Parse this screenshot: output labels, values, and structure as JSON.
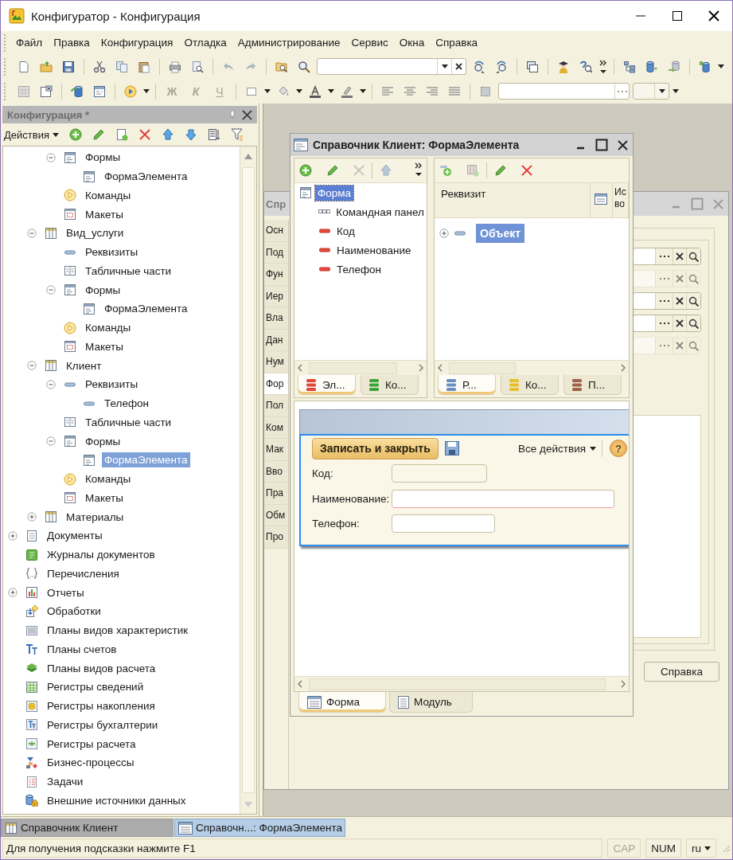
{
  "window": {
    "title": "Конфигуратор - Конфигурация"
  },
  "menu": [
    "Файл",
    "Правка",
    "Конфигурация",
    "Отладка",
    "Администрирование",
    "Сервис",
    "Окна",
    "Справка"
  ],
  "format_buttons": [
    {
      "label": "Ж",
      "disabled": true
    },
    {
      "label": "К",
      "disabled": true
    },
    {
      "label": "Ч",
      "disabled": true
    }
  ],
  "config": {
    "title": "Конфигурация *",
    "actions_label": "Действия",
    "tree": [
      {
        "children": [
          {
            "children": [
              {
                "label": "Формы",
                "kind": "forms",
                "expanded": true,
                "selected": false,
                "children": [
                  {
                    "label": "ФормаЭлемента",
                    "kind": "form",
                    "selected": false
                  }
                ]
              },
              {
                "label": "Команды",
                "kind": "commands",
                "selected": false
              },
              {
                "label": "Макеты",
                "kind": "templates",
                "selected": false
              }
            ]
          },
          {
            "label": "Вид_услуги",
            "kind": "catalog",
            "expanded": true,
            "selected": false,
            "children": [
              {
                "label": "Реквизиты",
                "kind": "attributes",
                "selected": false
              },
              {
                "label": "Табличные части",
                "kind": "tabular",
                "selected": false
              },
              {
                "label": "Формы",
                "kind": "forms",
                "expanded": true,
                "selected": false,
                "children": [
                  {
                    "label": "ФормаЭлемента",
                    "kind": "form",
                    "selected": false
                  }
                ]
              },
              {
                "label": "Команды",
                "kind": "commands",
                "selected": false
              },
              {
                "label": "Макеты",
                "kind": "templates",
                "selected": false
              }
            ]
          },
          {
            "label": "Клиент",
            "kind": "catalog",
            "expanded": true,
            "selected": false,
            "children": [
              {
                "label": "Реквизиты",
                "kind": "attributes",
                "expanded": true,
                "selected": false,
                "children": [
                  {
                    "label": "Телефон",
                    "kind": "attributes",
                    "selected": false
                  }
                ]
              },
              {
                "label": "Табличные части",
                "kind": "tabular",
                "selected": false
              },
              {
                "label": "Формы",
                "kind": "forms",
                "expanded": true,
                "selected": false,
                "children": [
                  {
                    "label": "ФормаЭлемента",
                    "kind": "form",
                    "selected": true
                  }
                ]
              },
              {
                "label": "Команды",
                "kind": "commands",
                "selected": false
              },
              {
                "label": "Макеты",
                "kind": "templates",
                "selected": false
              }
            ]
          },
          {
            "label": "Материалы",
            "kind": "catalog",
            "expanded": false,
            "selected": false
          }
        ]
      },
      {
        "label": "Документы",
        "kind": "documents",
        "expanded": false,
        "selected": false
      },
      {
        "label": "Журналы документов",
        "kind": "journals",
        "selected": false
      },
      {
        "label": "Перечисления",
        "kind": "enums",
        "selected": false
      },
      {
        "label": "Отчеты",
        "kind": "reports",
        "expanded": false,
        "selected": false
      },
      {
        "label": "Обработки",
        "kind": "processing",
        "selected": false
      },
      {
        "label": "Планы видов характеристик",
        "kind": "chars",
        "selected": false
      },
      {
        "label": "Планы счетов",
        "kind": "accounts",
        "selected": false
      },
      {
        "label": "Планы видов расчета",
        "kind": "calc_types",
        "selected": false
      },
      {
        "label": "Регистры сведений",
        "kind": "info_reg",
        "selected": false
      },
      {
        "label": "Регистры накопления",
        "kind": "accum_reg",
        "selected": false
      },
      {
        "label": "Регистры бухгалтерии",
        "kind": "account_reg",
        "selected": false
      },
      {
        "label": "Регистры расчета",
        "kind": "calc_reg",
        "selected": false
      },
      {
        "label": "Бизнес-процессы",
        "kind": "business",
        "selected": false
      },
      {
        "label": "Задачи",
        "kind": "tasks",
        "selected": false
      },
      {
        "label": "Внешние источники данных",
        "kind": "external",
        "selected": false
      }
    ]
  },
  "back_window": {
    "title": "Спр",
    "tabs": [
      {
        "label": "Осн",
        "selected": false
      },
      {
        "label": "Под",
        "selected": false
      },
      {
        "label": "Фун",
        "selected": false
      },
      {
        "label": "Иер",
        "selected": false
      },
      {
        "label": "Вла",
        "selected": false
      },
      {
        "label": "Дан",
        "selected": false
      },
      {
        "label": "Нум",
        "selected": false
      },
      {
        "label": "Фор",
        "selected": true
      },
      {
        "label": "Пол",
        "selected": false
      },
      {
        "label": "Ком",
        "selected": false
      },
      {
        "label": "Мак",
        "selected": false
      },
      {
        "label": "Вво",
        "selected": false
      },
      {
        "label": "Пра",
        "selected": false
      },
      {
        "label": "Обм",
        "selected": false
      },
      {
        "label": "Про",
        "selected": false
      }
    ],
    "fields": [
      {
        "disabled": false
      },
      {
        "disabled": true
      },
      {
        "disabled": false
      },
      {
        "disabled": false
      },
      {
        "disabled": true
      }
    ],
    "help_button": "Справка"
  },
  "form_window": {
    "title": "Справочник Клиент: ФормаЭлемента",
    "elements": {
      "tree": [
        {
          "label": "Форма",
          "kind": "form",
          "selected": true,
          "children": [
            {
              "label": "Командная панел",
              "kind": "command_bar",
              "selected": false
            },
            {
              "label": "Код",
              "kind": "field",
              "selected": false
            },
            {
              "label": "Наименование",
              "kind": "field",
              "selected": false
            },
            {
              "label": "Телефон",
              "kind": "field",
              "selected": false
            }
          ]
        }
      ],
      "tabs": [
        {
          "label": "Эл...",
          "color": "#e0463a",
          "selected": true
        },
        {
          "label": "Ко...",
          "color": "#3da43a",
          "selected": false
        }
      ]
    },
    "attributes": {
      "columns": [
        "Реквизит",
        "Ис во"
      ],
      "rows": [
        {
          "label": "Объект",
          "expanded": false,
          "selected": true
        }
      ],
      "tabs": [
        {
          "label": "Р...",
          "color": "#6a8fc0",
          "selected": true
        },
        {
          "label": "Ко...",
          "color": "#e6c02a",
          "selected": false
        },
        {
          "label": "П...",
          "color": "#a0604a",
          "selected": false
        }
      ]
    },
    "preview": {
      "save_button": "Записать и закрыть",
      "all_actions": "Все действия",
      "help": "?",
      "fields": [
        {
          "label": "Код:",
          "required": false
        },
        {
          "label": "Наименование:",
          "required": true
        },
        {
          "label": "Телефон:",
          "required": false
        }
      ]
    },
    "bottom_tabs": [
      {
        "label": "Форма",
        "selected": true
      },
      {
        "label": "Модуль",
        "selected": false
      }
    ]
  },
  "window_tabs": [
    {
      "label": "Справочник Клиент",
      "selected": false
    },
    {
      "label": "Справочн...: ФормаЭлемента",
      "selected": true
    }
  ],
  "status_bar": {
    "hint": "Для получения подсказки нажмите F1",
    "indicators": [
      {
        "label": "CAP",
        "on": false
      },
      {
        "label": "NUM",
        "on": true
      }
    ],
    "language": "ru"
  }
}
